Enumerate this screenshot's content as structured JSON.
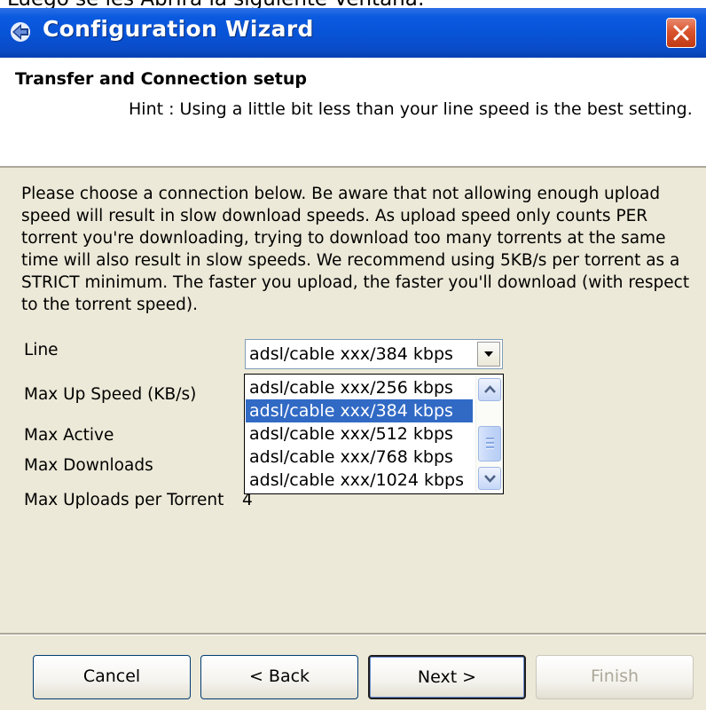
{
  "caption": "Luego se les Abrirá la siguiente Ventana:",
  "window": {
    "title": "Configuration Wizard",
    "close_glyph": "✕"
  },
  "header": {
    "title": "Transfer and Connection setup",
    "hint": "Hint : Using a little bit less than your line speed is the best setting."
  },
  "intro_text": "Please choose a connection below. Be aware that not allowing enough upload speed will result in slow download speeds. As upload speed only counts PER torrent you're downloading, trying to download too many torrents at the same time will also result in slow speeds. We recommend using 5KB/s per torrent as a STRICT minimum. The faster you upload, the faster you'll download (with respect to the torrent speed).",
  "form": {
    "line_label": "Line",
    "line_value": "adsl/cable xxx/384 kbps",
    "options": [
      "adsl/cable xxx/256 kbps",
      "adsl/cable xxx/384 kbps",
      "adsl/cable xxx/512 kbps",
      "adsl/cable xxx/768 kbps",
      "adsl/cable xxx/1024 kbps"
    ],
    "selected_index": 1,
    "max_up_label": "Max Up Speed (KB/s)",
    "max_active_label": "Max Active",
    "max_downloads_label": "Max Downloads",
    "max_uploads_label": "Max Uploads per Torrent",
    "max_uploads_value": "4"
  },
  "buttons": {
    "cancel": "Cancel",
    "back": "< Back",
    "next": "Next >",
    "finish": "Finish"
  },
  "colors": {
    "titlebar": "#0853d6",
    "window_bg": "#ece9d8",
    "selection": "#316ac5",
    "close_button": "#d9542c"
  },
  "icons": {
    "app": "wizard-app-icon",
    "close": "close-icon",
    "combo_arrow": "chevron-down-icon",
    "scroll_up": "chevron-up-icon",
    "scroll_down": "chevron-down-icon"
  }
}
